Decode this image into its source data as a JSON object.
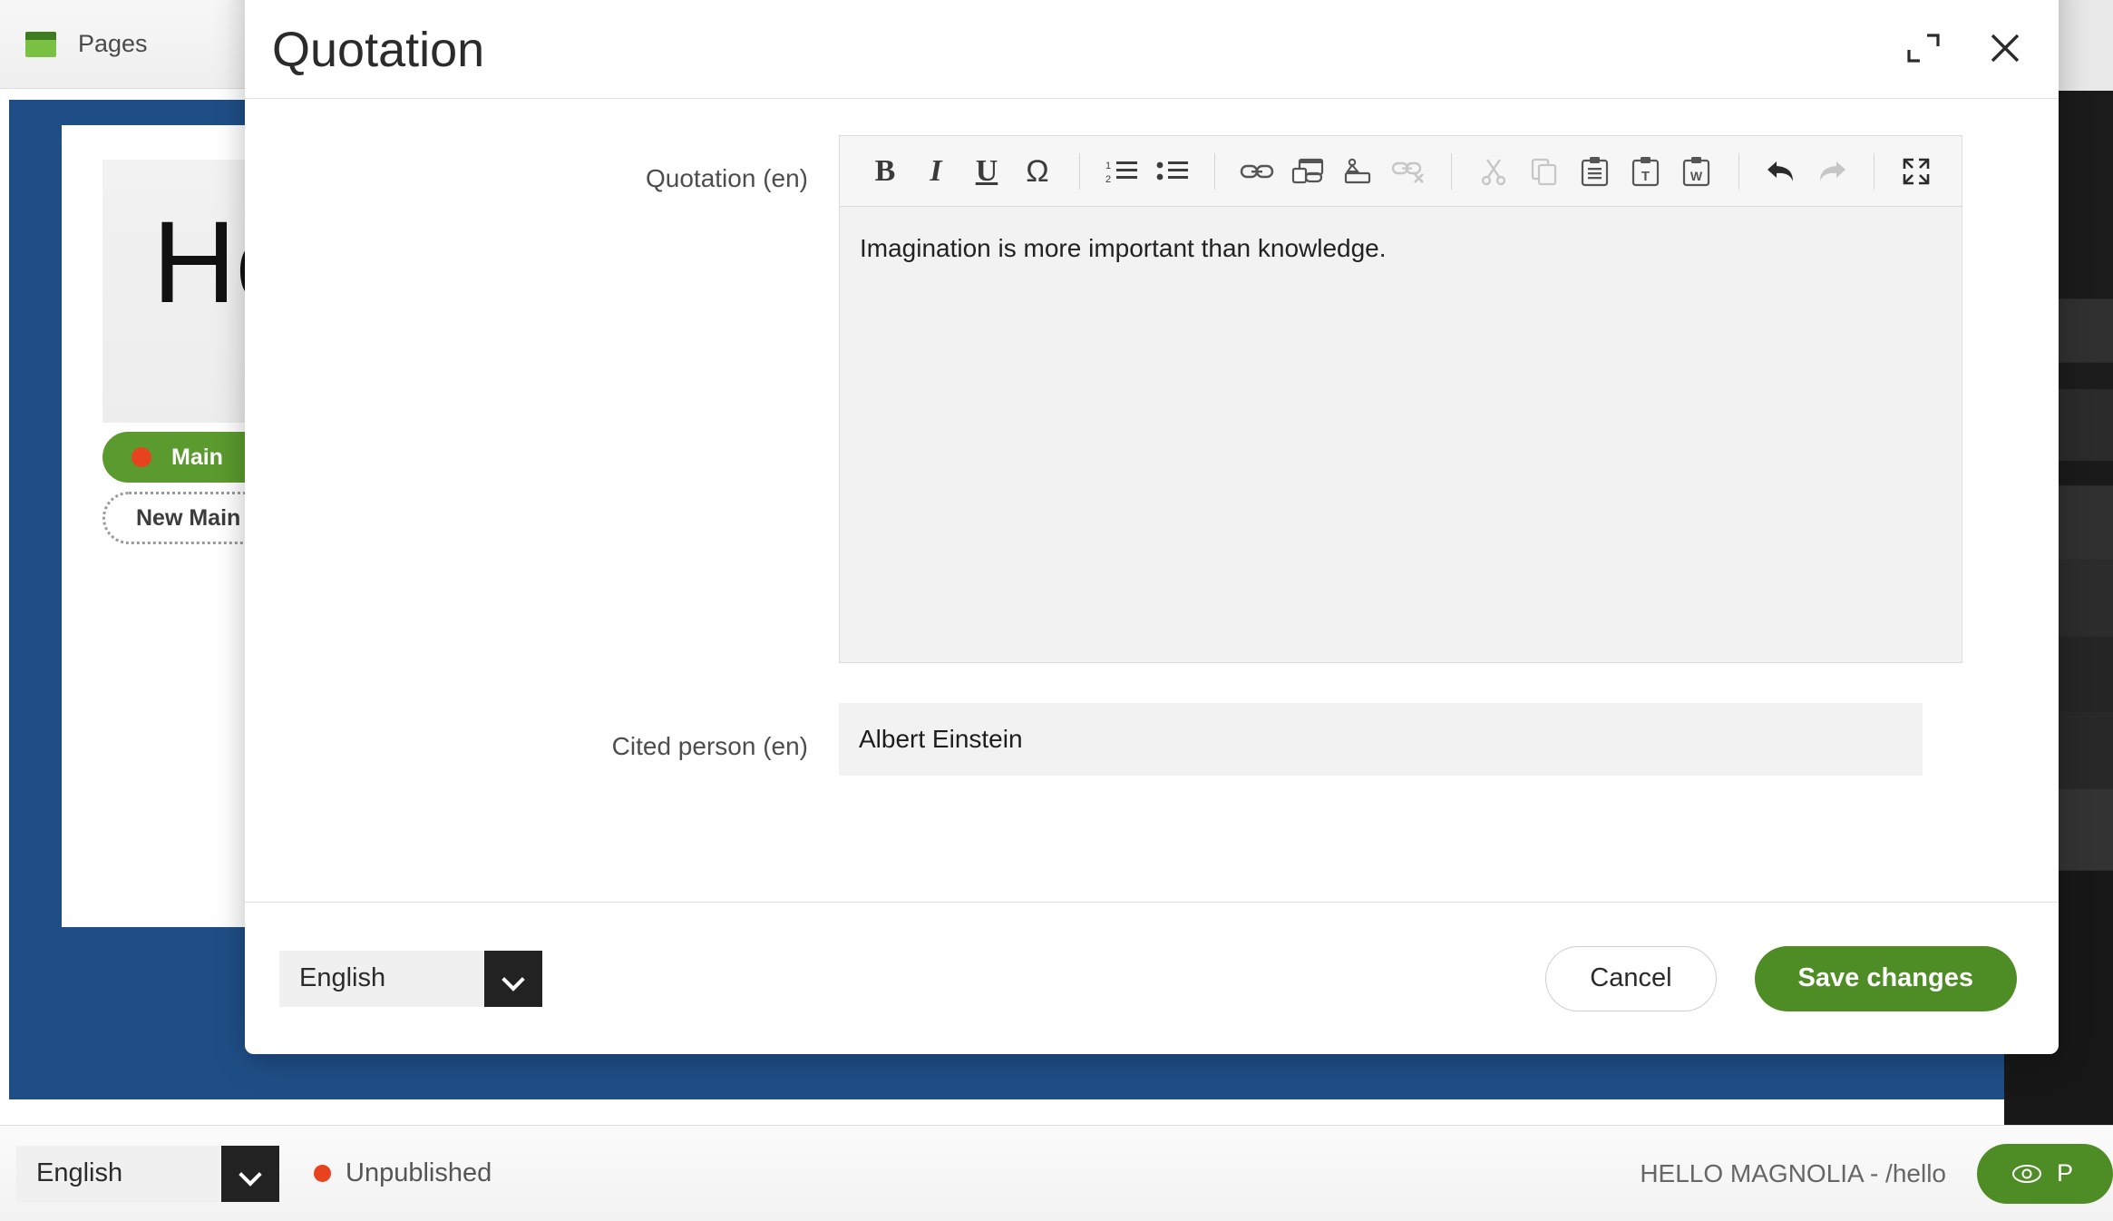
{
  "app": {
    "tab": {
      "label": "Pages",
      "icon": "pages-icon"
    },
    "page_preview": {
      "heading": "He",
      "main_area_label": "Main",
      "new_component_label": "New Main Co"
    },
    "statusbar": {
      "language": "English",
      "publish_status": "Unpublished",
      "page_path": "HELLO MAGNOLIA - /hello",
      "preview_label": "P",
      "preview_icon": "eye-icon"
    }
  },
  "dialog": {
    "title": "Quotation",
    "maximize_icon": "maximize-icon",
    "close_icon": "close-icon",
    "fields": {
      "quotation": {
        "label": "Quotation (en)",
        "value": "Imagination is more important than knowledge."
      },
      "cited_person": {
        "label": "Cited person (en)",
        "value": "Albert Einstein"
      }
    },
    "toolbar": [
      {
        "name": "bold-icon",
        "title": "Bold",
        "disabled": false
      },
      {
        "name": "italic-icon",
        "title": "Italic",
        "disabled": false
      },
      {
        "name": "underline-icon",
        "title": "Underline",
        "disabled": false
      },
      {
        "name": "special-character-icon",
        "title": "Special Character",
        "disabled": false
      },
      {
        "name": "separator",
        "title": "",
        "disabled": false
      },
      {
        "name": "numbered-list-icon",
        "title": "Numbered List",
        "disabled": false
      },
      {
        "name": "bulleted-list-icon",
        "title": "Bulleted List",
        "disabled": false
      },
      {
        "name": "separator",
        "title": "",
        "disabled": false
      },
      {
        "name": "link-icon",
        "title": "Link",
        "disabled": false
      },
      {
        "name": "page-link-icon",
        "title": "Internal Link",
        "disabled": false
      },
      {
        "name": "anchor-icon",
        "title": "Anchor",
        "disabled": false
      },
      {
        "name": "unlink-icon",
        "title": "Unlink",
        "disabled": true
      },
      {
        "name": "separator",
        "title": "",
        "disabled": false
      },
      {
        "name": "cut-icon",
        "title": "Cut",
        "disabled": true
      },
      {
        "name": "copy-icon",
        "title": "Copy",
        "disabled": true
      },
      {
        "name": "paste-icon",
        "title": "Paste",
        "disabled": false
      },
      {
        "name": "paste-text-icon",
        "title": "Paste as plain text",
        "disabled": false
      },
      {
        "name": "paste-word-icon",
        "title": "Paste from Word",
        "disabled": false
      },
      {
        "name": "separator",
        "title": "",
        "disabled": false
      },
      {
        "name": "undo-icon",
        "title": "Undo",
        "disabled": false
      },
      {
        "name": "redo-icon",
        "title": "Redo",
        "disabled": true
      },
      {
        "name": "separator",
        "title": "",
        "disabled": false
      },
      {
        "name": "maximize-editor-icon",
        "title": "Maximize",
        "disabled": false
      }
    ],
    "footer": {
      "language": "English",
      "cancel_label": "Cancel",
      "save_label": "Save changes"
    }
  },
  "colors": {
    "brand_green": "#4e8c25",
    "accent_green": "#7ac143",
    "canvas_blue": "#1f4e87",
    "status_red": "#e8431f",
    "dark_rail": "#1d1d1d"
  }
}
